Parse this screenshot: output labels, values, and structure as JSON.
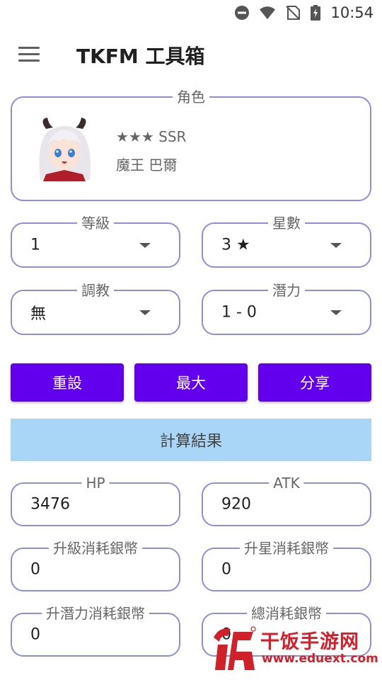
{
  "status_bar": {
    "time": "10:54",
    "icons": [
      "dnd-icon",
      "wifi-icon",
      "no-signal-icon",
      "battery-icon"
    ]
  },
  "app_bar": {
    "title": "TKFM 工具箱",
    "menu_icon": "menu-icon"
  },
  "character": {
    "label": "角色",
    "rarity": "★★★ SSR",
    "name": "魔王 巴爾"
  },
  "selectors": {
    "level": {
      "label": "等級",
      "value": "1"
    },
    "stars": {
      "label": "星數",
      "value": "3 ★"
    },
    "training": {
      "label": "調教",
      "value": "無"
    },
    "potential": {
      "label": "潛力",
      "value": "1 - 0"
    }
  },
  "buttons": {
    "reset": "重設",
    "max": "最大",
    "share": "分享"
  },
  "results": {
    "header": "計算結果",
    "hp": {
      "label": "HP",
      "value": "3476"
    },
    "atk": {
      "label": "ATK",
      "value": "920"
    },
    "level_cost": {
      "label": "升級消耗銀幣",
      "value": "0"
    },
    "star_cost": {
      "label": "升星消耗銀幣",
      "value": "0"
    },
    "potential_cost": {
      "label": "升潛力消耗銀幣",
      "value": "0"
    },
    "total_cost": {
      "label": "總消耗銀幣",
      "value": "0"
    }
  },
  "watermark": {
    "text": "干饭手游网",
    "url": "www.eduext.com"
  },
  "colors": {
    "accent": "#6200ee",
    "outline": "#8c8ed6",
    "result_bar": "#a9d6f7",
    "watermark": "#d0202a"
  }
}
